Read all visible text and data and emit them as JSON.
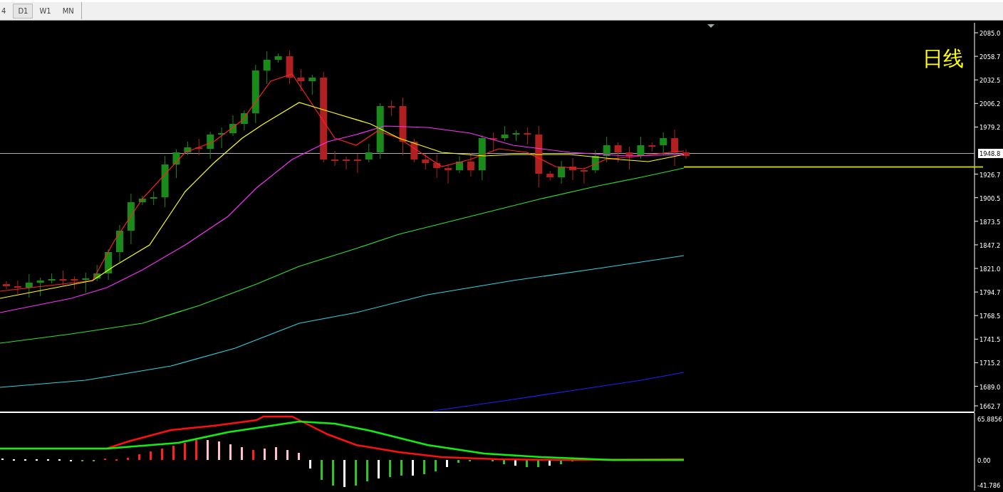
{
  "timeframe_tabs": [
    {
      "label": "4",
      "selected": false
    },
    {
      "label": "D1",
      "selected": true
    },
    {
      "label": "W1",
      "selected": false
    },
    {
      "label": "MN",
      "selected": false
    }
  ],
  "chart_label": "日线",
  "price_axis": {
    "ticks": [
      "2085.0",
      "2058.7",
      "2032.5",
      "2006.2",
      "1979.2",
      "1926.7",
      "1900.5",
      "1873.5",
      "1847.2",
      "1821.0",
      "1794.7",
      "1768.5",
      "1741.5",
      "1715.2",
      "1689.0",
      "1662.7"
    ],
    "current_price": "1948.8"
  },
  "indicator_axis": {
    "ticks": [
      "65.8856",
      "0.00",
      "-41.786"
    ]
  }
}
